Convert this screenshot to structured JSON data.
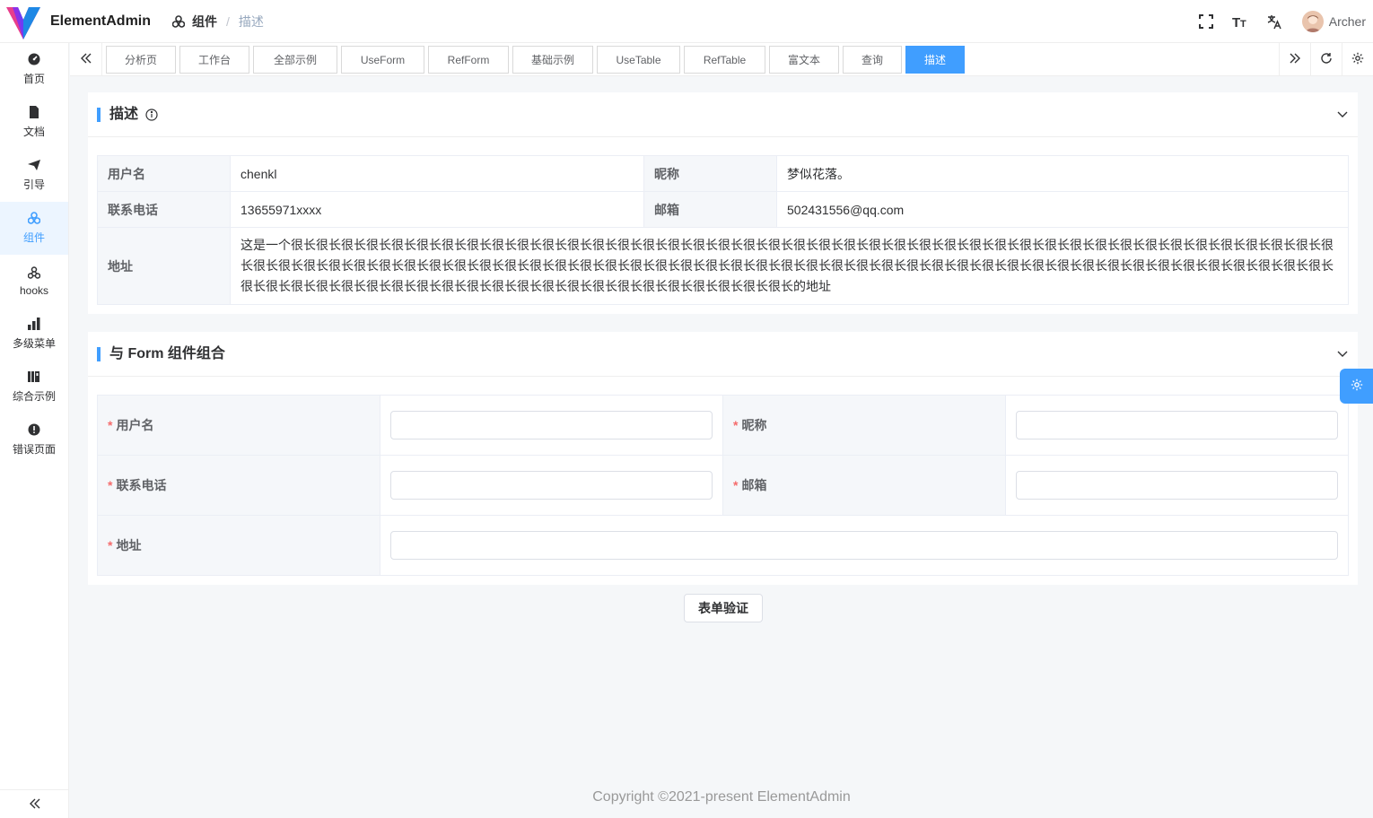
{
  "header": {
    "app_title": "ElementAdmin",
    "breadcrumb": [
      "组件",
      "描述"
    ],
    "user_name": "Archer",
    "icons": [
      "fullscreen-icon",
      "font-size-icon",
      "translate-icon"
    ]
  },
  "sidebar": {
    "items": [
      {
        "label": "首页",
        "icon": "dashboard-icon"
      },
      {
        "label": "文档",
        "icon": "document-icon"
      },
      {
        "label": "引导",
        "icon": "send-icon"
      },
      {
        "label": "组件",
        "icon": "components-icon",
        "active": true
      },
      {
        "label": "hooks",
        "icon": "hooks-icon"
      },
      {
        "label": "多级菜单",
        "icon": "bar-chart-icon"
      },
      {
        "label": "综合示例",
        "icon": "book-icon"
      },
      {
        "label": "错误页面",
        "icon": "error-icon"
      }
    ]
  },
  "tags": [
    {
      "label": "分析页"
    },
    {
      "label": "工作台"
    },
    {
      "label": "全部示例"
    },
    {
      "label": "UseForm"
    },
    {
      "label": "RefForm"
    },
    {
      "label": "基础示例"
    },
    {
      "label": "UseTable"
    },
    {
      "label": "RefTable"
    },
    {
      "label": "富文本"
    },
    {
      "label": "查询"
    },
    {
      "label": "描述",
      "active": true
    }
  ],
  "desc_card": {
    "title": "描述",
    "rows": {
      "username_label": "用户名",
      "username_value": "chenkl",
      "nickname_label": "昵称",
      "nickname_value": "梦似花落。",
      "phone_label": "联系电话",
      "phone_value": "13655971xxxx",
      "email_label": "邮箱",
      "email_value": "502431556@qq.com",
      "address_label": "地址",
      "address_value": "这是一个很长很长很长很长很长很长很长很长很长很长很长很长很长很长很长很长很长很长很长很长很长很长很长很长很长很长很长很长很长很长很长很长很长很长很长很长很长很长很长很长很长很长很长很长很长很长很长很长很长很长很长很长很长很长很长很长很长很长很长很长很长很长很长很长很长很长很长很长很长很长很长很长很长很长很长很长很长很长很长很长很长很长很长很长很长很长很长很长很长很长很长很长很长很长很长很长很长很长很长很长很长很长很长很长很长很长很长的地址"
    }
  },
  "form_card": {
    "title": "与 Form 组件组合",
    "required_mark": "*",
    "fields": {
      "username": "用户名",
      "nickname": "昵称",
      "phone": "联系电话",
      "email": "邮箱",
      "address": "地址"
    },
    "values": {
      "username": "",
      "nickname": "",
      "phone": "",
      "email": "",
      "address": ""
    }
  },
  "validate_button": "表单验证",
  "footer": "Copyright ©2021-present ElementAdmin",
  "colors": {
    "primary": "#409eff",
    "required": "#f56c6c"
  }
}
